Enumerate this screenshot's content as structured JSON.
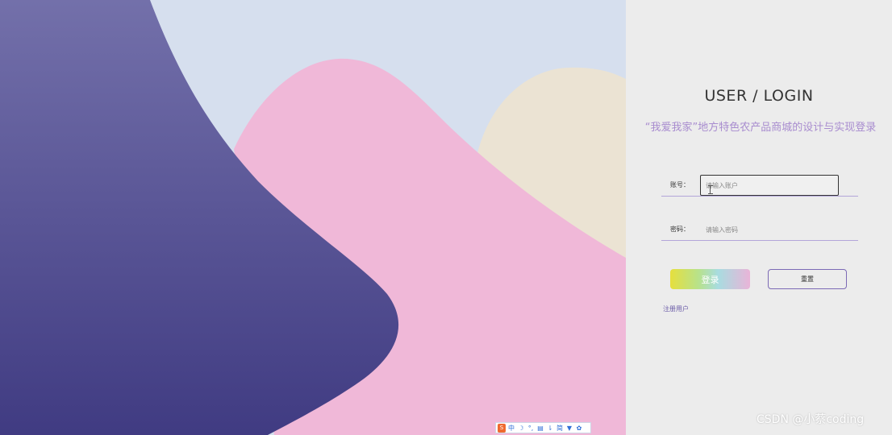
{
  "login": {
    "title": "USER / LOGIN",
    "system_title": "“我爱我家”地方特色农产品商城的设计与实现登录",
    "account_label": "账号：",
    "account_placeholder": "请输入账户",
    "password_label": "密码：",
    "password_placeholder": "请输入密码",
    "login_button": "登录",
    "reset_button": "重置",
    "register_link": "注册用户"
  },
  "watermark": "CSDN @小蔡coding",
  "ime_toolbar": {
    "items": [
      {
        "name": "ime-logo-icon",
        "glyph": "S"
      },
      {
        "name": "ime-chinese-mode",
        "glyph": "中"
      },
      {
        "name": "ime-moon-icon",
        "glyph": "☽"
      },
      {
        "name": "ime-punctuation-icon",
        "glyph": "°,"
      },
      {
        "name": "ime-keyboard-icon",
        "glyph": "▤"
      },
      {
        "name": "ime-mic-icon",
        "glyph": "⇂"
      },
      {
        "name": "ime-simplified-mode",
        "glyph": "简"
      },
      {
        "name": "ime-skin-icon",
        "glyph": "▼"
      },
      {
        "name": "ime-settings-icon",
        "glyph": "✿"
      }
    ]
  },
  "colors": {
    "sky": "#d6dfee",
    "pink_hill": "#f0b8d8",
    "cream_hill": "#ebe3d3",
    "purple_wave_top": "#7370aa",
    "purple_wave_bottom": "#403b82",
    "panel_bg": "#ececec",
    "accent_purple": "#a88ccf"
  }
}
